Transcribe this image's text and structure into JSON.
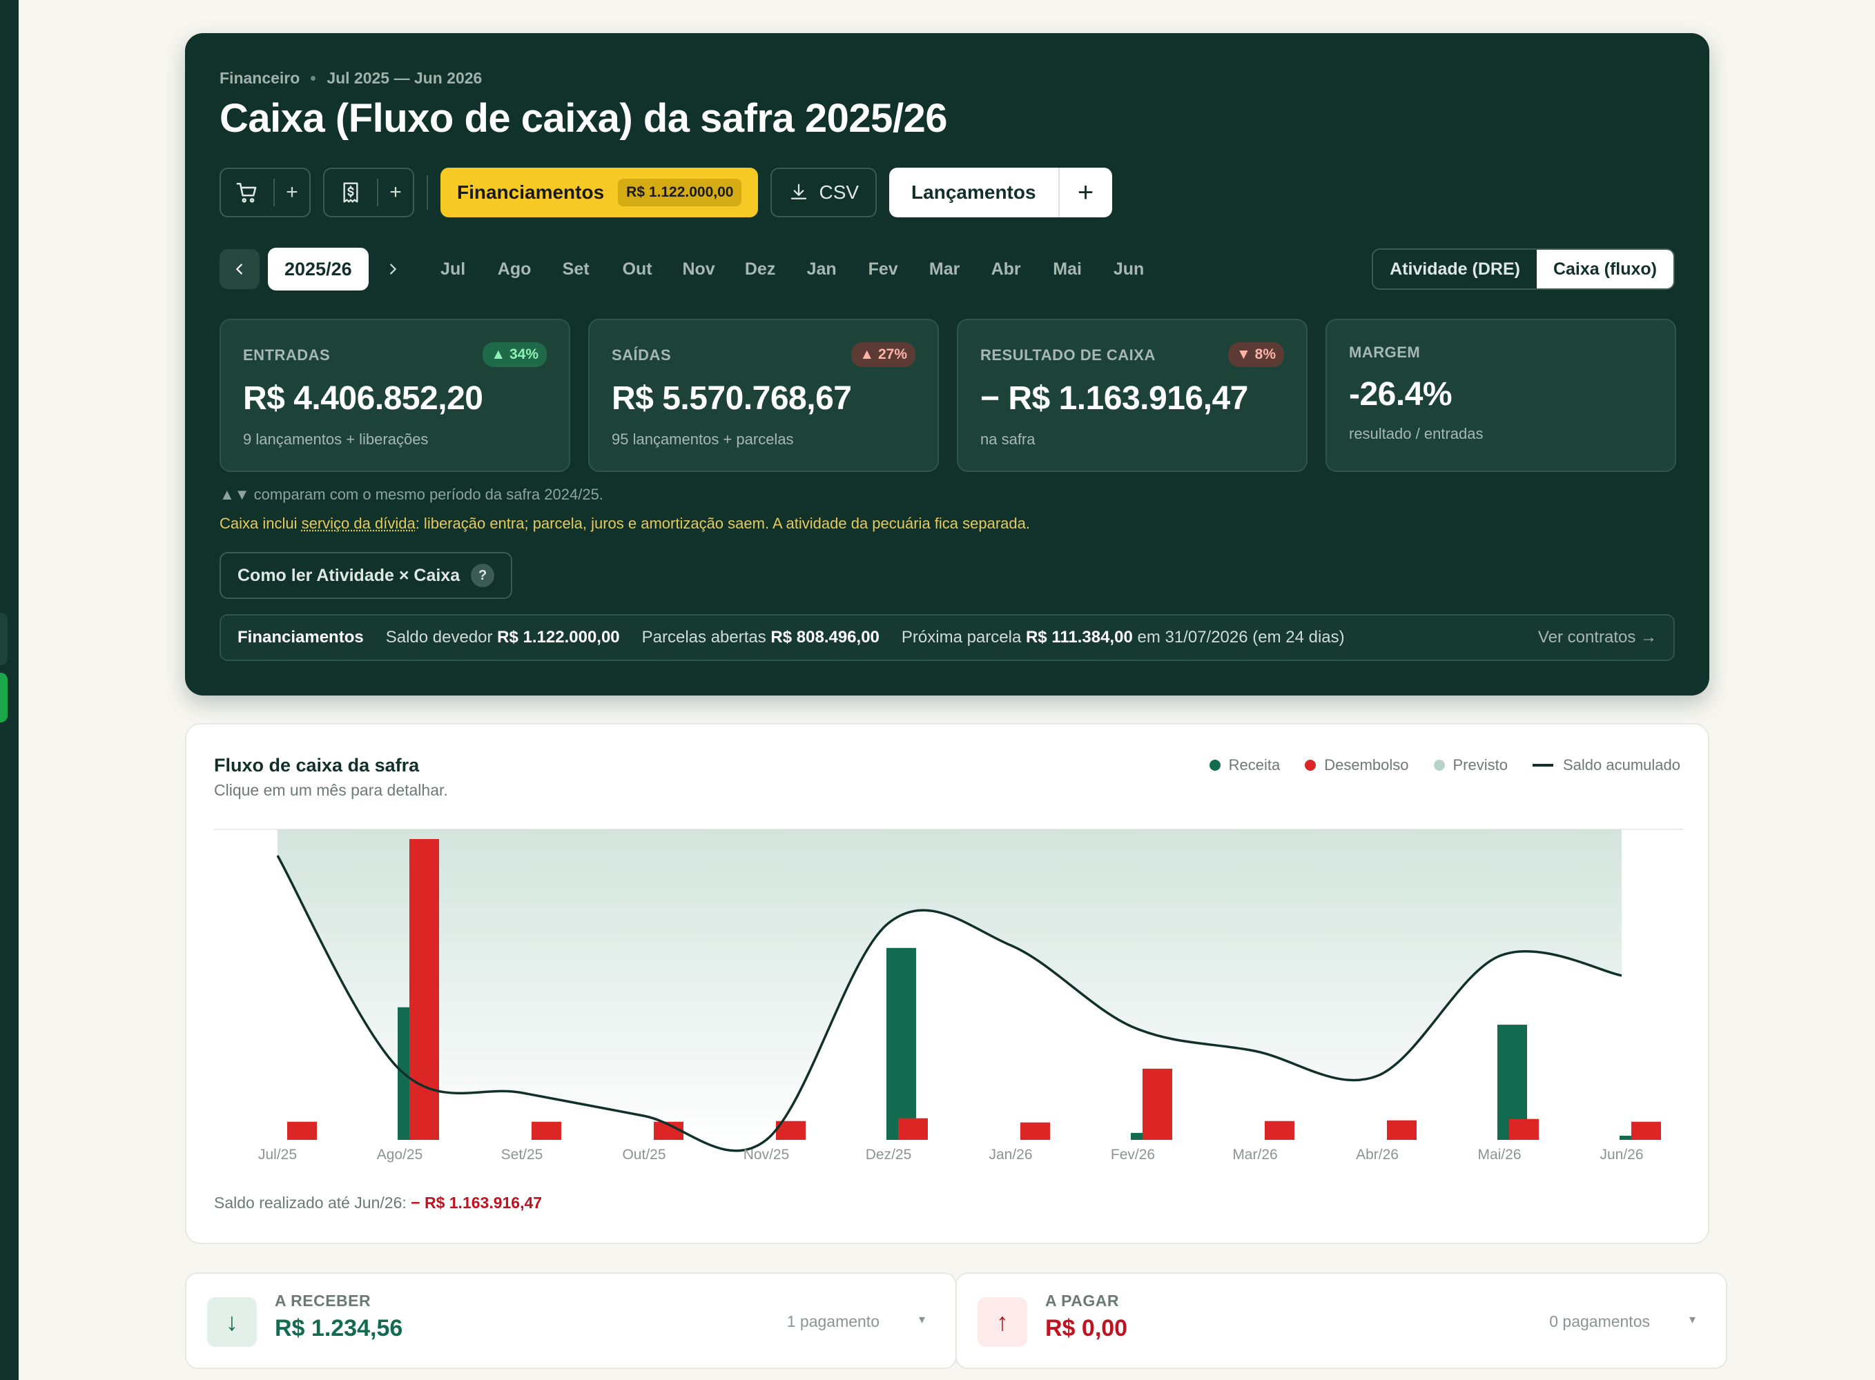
{
  "breadcrumb": {
    "section": "Financeiro",
    "period": "Jul 2025 — Jun 2026"
  },
  "title": "Caixa (Fluxo de caixa) da safra 2025/26",
  "toolbar": {
    "financiamentos_label": "Financiamentos",
    "financiamentos_badge": "R$ 1.122.000,00",
    "csv_label": "CSV",
    "lancamentos_label": "Lançamentos",
    "plus": "+"
  },
  "period": {
    "season": "2025/26",
    "months": [
      "Jul",
      "Ago",
      "Set",
      "Out",
      "Nov",
      "Dez",
      "Jan",
      "Fev",
      "Mar",
      "Abr",
      "Mai",
      "Jun"
    ],
    "view_options": [
      "Atividade (DRE)",
      "Caixa (fluxo)"
    ],
    "active_view": "Caixa (fluxo)"
  },
  "cards": [
    {
      "label": "ENTRADAS",
      "change": "▲ 34%",
      "value": "R$ 4.406.852,20",
      "sub": "9 lançamentos + liberações"
    },
    {
      "label": "SAÍDAS",
      "change": "▲ 27%",
      "value": "R$ 5.570.768,67",
      "sub": "95 lançamentos + parcelas"
    },
    {
      "label": "RESULTADO DE CAIXA",
      "change": "▼ 8%",
      "value": "− R$ 1.163.916,47",
      "sub": "na safra"
    },
    {
      "label": "MARGEM",
      "value": "-26.4%",
      "sub": "resultado / entradas"
    }
  ],
  "notes": {
    "compare": "▲▼ comparam com o mesmo período da safra 2024/25.",
    "caixa_prefix": "Caixa inclui ",
    "caixa_link": "serviço da dívida",
    "caixa_suffix": ": liberação entra; parcela, juros e amortização saem. A atividade da pecuária fica separada."
  },
  "howto": {
    "label": "Como ler Atividade × Caixa",
    "icon": "?"
  },
  "financing": {
    "title": "Financiamentos",
    "saldo_label": "Saldo devedor",
    "saldo_value": "R$ 1.122.000,00",
    "parcelas_label": "Parcelas abertas",
    "parcelas_value": "R$ 808.496,00",
    "proxima_label": "Próxima parcela",
    "proxima_value": "R$ 111.384,00",
    "proxima_suffix": "em 31/07/2026 (em 24 dias)",
    "link": "Ver contratos →"
  },
  "chart": {
    "title": "Fluxo de caixa da safra",
    "subtitle": "Clique em um mês para detalhar.",
    "legend": [
      "Receita",
      "Desembolso",
      "Previsto",
      "Saldo acumulado"
    ],
    "saldo_label": "Saldo realizado até Jun/26:",
    "saldo_value": "− R$ 1.163.916,47"
  },
  "chart_data": {
    "type": "bar",
    "categories": [
      "Jul/25",
      "Ago/25",
      "Set/25",
      "Out/25",
      "Nov/25",
      "Dez/25",
      "Jan/26",
      "Fev/26",
      "Mar/26",
      "Abr/26",
      "Mai/26",
      "Jun/26"
    ],
    "series": [
      {
        "name": "Receita",
        "values": [
          0,
          1900000,
          0,
          0,
          0,
          2750000,
          0,
          100000,
          0,
          0,
          1650000,
          40000
        ]
      },
      {
        "name": "Desembolso",
        "values": [
          260000,
          4310000,
          260000,
          260000,
          270000,
          310000,
          250000,
          1020000,
          270000,
          280000,
          300000,
          260000
        ]
      },
      {
        "name": "Saldo acumulado",
        "values": [
          -260000,
          -2670000,
          -2930000,
          -3190000,
          -3460000,
          -1020000,
          -1270000,
          -2190000,
          -2460000,
          -2740000,
          -1390000,
          -1610000
        ]
      }
    ],
    "colors": {
      "Receita": "#136b4f",
      "Desembolso": "#dc2626",
      "Previsto": "#b7d3c8",
      "Saldo acumulado": "#12302a"
    },
    "grid": false,
    "legend_position": "top-right"
  },
  "summary": {
    "receber": {
      "label": "A RECEBER",
      "value": "R$ 1.234,56",
      "count": "1 pagamento",
      "icon": "↓"
    },
    "pagar": {
      "label": "A PAGAR",
      "value": "R$ 0,00",
      "count": "0 pagamentos",
      "icon": "↑"
    },
    "caret": "▾"
  }
}
